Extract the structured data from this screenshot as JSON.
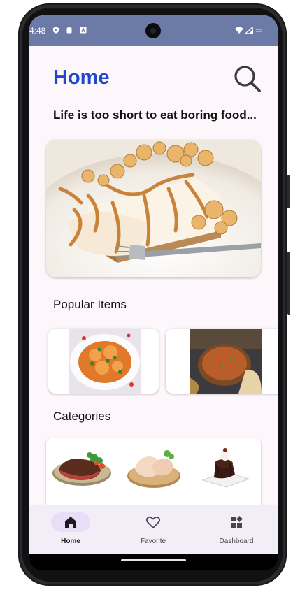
{
  "status_bar": {
    "time": "4:48",
    "left_icons": [
      "play-protect-icon",
      "clipboard-icon",
      "accessibility-icon"
    ],
    "right_icons": [
      "wifi-icon",
      "signal-icon",
      "battery-icon"
    ],
    "background_color": "#6b7aa6"
  },
  "header": {
    "title": "Home",
    "search_icon": "search-icon",
    "title_color": "#1f49c9"
  },
  "tagline": "Life is too short to eat boring food...",
  "hero": {
    "image": "caramel-popcorn-cheesecake-photo"
  },
  "popular": {
    "title": "Popular Items",
    "items": [
      {
        "image": "chicken-curry-plate-photo"
      },
      {
        "image": "soup-bowl-photo"
      }
    ]
  },
  "categories": {
    "title": "Categories",
    "items": [
      {
        "image": "steak-plate-photo"
      },
      {
        "image": "raw-chicken-board-photo"
      },
      {
        "image": "chocolate-dessert-photo"
      }
    ]
  },
  "bottom_nav": {
    "items": [
      {
        "label": "Home",
        "icon": "home-icon",
        "active": true
      },
      {
        "label": "Favorite",
        "icon": "heart-icon",
        "active": false
      },
      {
        "label": "Dashboard",
        "icon": "dashboard-icon",
        "active": false
      }
    ],
    "active_pill_color": "#e8def8"
  }
}
